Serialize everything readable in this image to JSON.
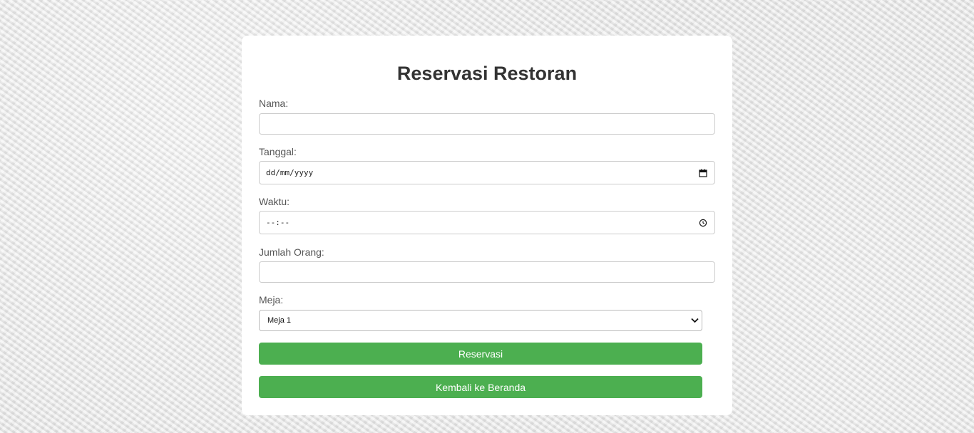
{
  "form": {
    "title": "Reservasi Restoran",
    "nama": {
      "label": "Nama:",
      "value": ""
    },
    "tanggal": {
      "label": "Tanggal:",
      "value": "dd/mm/yyyy"
    },
    "waktu": {
      "label": "Waktu:",
      "value": "--:--"
    },
    "jumlah_orang": {
      "label": "Jumlah Orang:",
      "value": ""
    },
    "meja": {
      "label": "Meja:",
      "selected": "Meja 1"
    },
    "submit_label": "Reservasi",
    "back_label": "Kembali ke Beranda"
  },
  "colors": {
    "button": "#4caf50",
    "card": "#ffffff",
    "title": "#333333"
  },
  "icons": {
    "tanggal": "calendar-icon",
    "waktu": "clock-icon",
    "meja": "chevron-down-icon"
  }
}
